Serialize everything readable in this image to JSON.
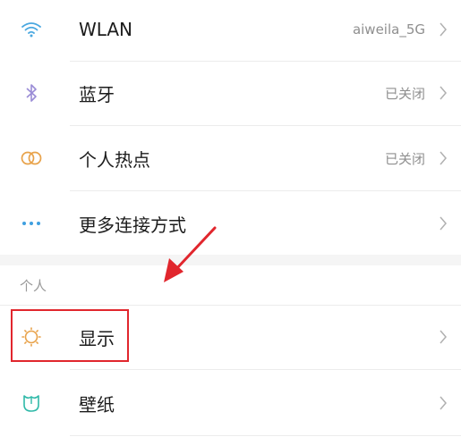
{
  "network_items": [
    {
      "label": "WLAN",
      "value": "aiweila_5G",
      "icon": "wifi-icon"
    },
    {
      "label": "蓝牙",
      "value": "已关闭",
      "icon": "bluetooth-icon"
    },
    {
      "label": "个人热点",
      "value": "已关闭",
      "icon": "hotspot-icon"
    },
    {
      "label": "更多连接方式",
      "value": "",
      "icon": "more-dots-icon"
    }
  ],
  "personal_section": {
    "header": "个人",
    "items": [
      {
        "label": "显示",
        "icon": "sun-icon"
      },
      {
        "label": "壁纸",
        "icon": "wallpaper-icon"
      }
    ]
  },
  "colors": {
    "highlight": "#e1262d",
    "arrow": "#e1262d",
    "wifi_icon": "#4aa8e0",
    "bluetooth_icon": "#9a8cd6",
    "hotspot_icon": "#e8a24a",
    "dots_icon": "#3f9fe0",
    "sun_icon": "#e8a24a",
    "wallpaper_icon": "#2fb9a8"
  }
}
